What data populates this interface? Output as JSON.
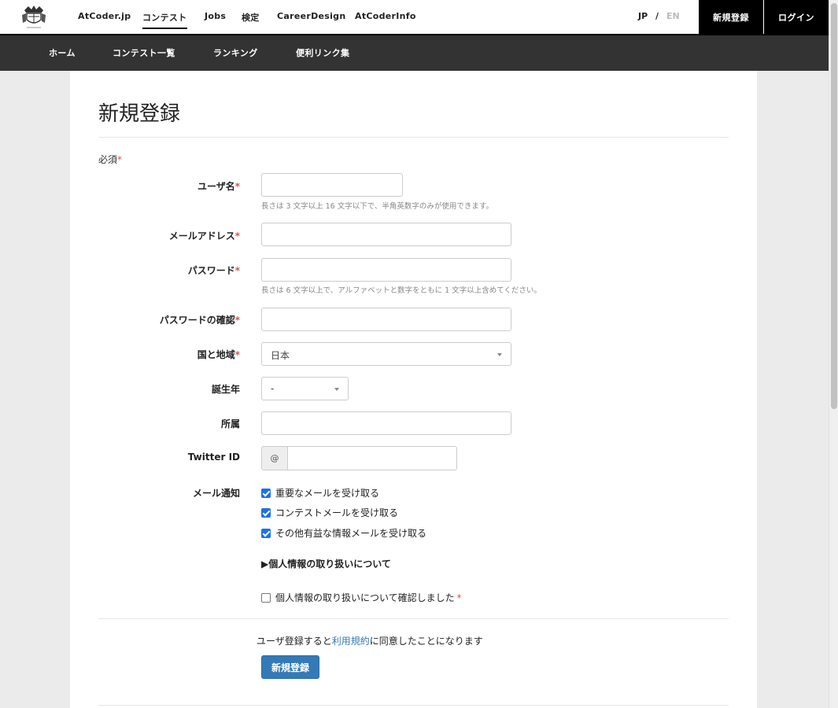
{
  "header": {
    "nav": [
      "AtCoder.jp",
      "コンテスト",
      "Jobs",
      "検定",
      "CareerDesign",
      "AtCoderInfo"
    ],
    "lang_jp": "JP",
    "lang_sep": "/",
    "lang_en": "EN",
    "signup": "新規登録",
    "login": "ログイン"
  },
  "subnav": [
    "ホーム",
    "コンテスト一覧",
    "ランキング",
    "便利リンク集"
  ],
  "page": {
    "title": "新規登録",
    "required_note": "必須",
    "required_mark": "*"
  },
  "form": {
    "username_label": "ユーザ名",
    "username_help": "長さは 3 文字以上 16 文字以下で、半角英数字のみが使用できます。",
    "email_label": "メールアドレス",
    "password_label": "パスワード",
    "password_help": "長さは 6 文字以上で、アルファベットと数字をともに 1 文字以上含めてください。",
    "password_confirm_label": "パスワードの確認",
    "country_label": "国と地域",
    "country_value": "日本",
    "birth_year_label": "誕生年",
    "birth_year_value": "-",
    "affiliation_label": "所属",
    "twitter_label": "Twitter ID",
    "twitter_prefix": "@",
    "mail_label": "メール通知",
    "mail_options": [
      {
        "label": "重要なメールを受け取る",
        "checked": true
      },
      {
        "label": "コンテストメールを受け取る",
        "checked": true
      },
      {
        "label": "その他有益な情報メールを受け取る",
        "checked": true
      }
    ],
    "privacy_toggle": "▶個人情報の取り扱いについて",
    "privacy_confirm": "個人情報の取り扱いについて確認しました",
    "privacy_confirm_checked": false,
    "agree_prefix": "ユーザ登録すると",
    "agree_link": "利用規約",
    "agree_suffix": "に同意したことになります",
    "submit_label": "新規登録"
  },
  "colors": {
    "accent": "#337ab7",
    "required": "#d9534f",
    "subnav_bg": "#333333",
    "checkbox": "#1a73e8"
  }
}
